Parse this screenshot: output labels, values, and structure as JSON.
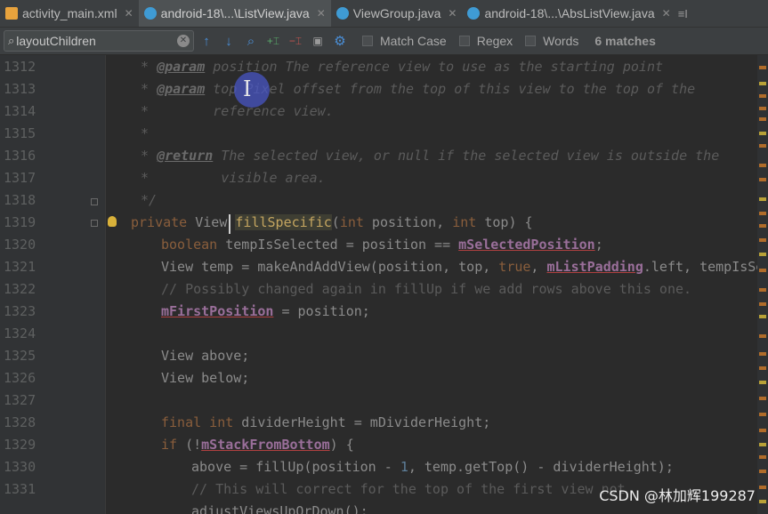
{
  "tabs": [
    {
      "label": "activity_main.xml",
      "kind": "xml",
      "active": false
    },
    {
      "label": "android-18\\...\\ListView.java",
      "kind": "java",
      "active": true
    },
    {
      "label": "ViewGroup.java",
      "kind": "java",
      "active": false
    },
    {
      "label": "android-18\\...\\AbsListView.java",
      "kind": "java",
      "active": false
    }
  ],
  "tab_overflow": "≡I",
  "search": {
    "value": "layoutChildren",
    "match_case_label": "Match Case",
    "regex_label": "Regex",
    "words_label": "Words",
    "match_count": "6 matches"
  },
  "editor": {
    "line_numbers": [
      "1312",
      "1313",
      "1314",
      "1315",
      "1316",
      "1317",
      "1318",
      "1319",
      "1320",
      "1321",
      "1322",
      "1323",
      "1324",
      "1325",
      "1326",
      "1327",
      "1328",
      "1329",
      "1330",
      "1331"
    ],
    "code": {
      "l1312a": "* ",
      "l1312b": "@param",
      "l1312c": " position The reference view to use as the starting point",
      "l1313a": "* ",
      "l1313b": "@param",
      "l1313c": " top Pixel offset from the top of this view to the top of the",
      "l1314": "*        reference view.",
      "l1315": "*",
      "l1316a": "* ",
      "l1316b": "@return",
      "l1316c": " The selected view, or null if the selected view is outside the",
      "l1317": "*         visible area.",
      "l1318": "*/",
      "l1319a": "private ",
      "l1319b": "View ",
      "l1319c": "fillSpecific",
      "l1319d": "(",
      "l1319e": "int",
      "l1319f": " position, ",
      "l1319g": "int",
      "l1319h": " top) {",
      "l1320a": "boolean",
      "l1320b": " tempIsSelected = position == ",
      "l1320c": "mSelectedPosition",
      "l1320d": ";",
      "l1321a": "View temp = makeAndAddView(position, top, ",
      "l1321b": "true",
      "l1321c": ", ",
      "l1321d": "mListPadding",
      "l1321e": ".left, tempIsSelected",
      "l1322": "// Possibly changed again in fillUp if we add rows above this one.",
      "l1323a": "mFirstPosition",
      "l1323b": " = position;",
      "l1325": "View above;",
      "l1326": "View below;",
      "l1328a": "final int",
      "l1328b": " dividerHeight = mDividerHeight;",
      "l1329a": "if",
      "l1329b": " (!",
      "l1329c": "mStackFromBottom",
      "l1329d": ") {",
      "l1330a": "above = fillUp(position - ",
      "l1330b": "1",
      "l1330c": ", temp.getTop() - dividerHeight);",
      "l1331": "// This will correct for the top of the first view not",
      "l1332": "adjustViewsUpOrDown();"
    }
  },
  "watermark": "CSDN @林加辉199287"
}
